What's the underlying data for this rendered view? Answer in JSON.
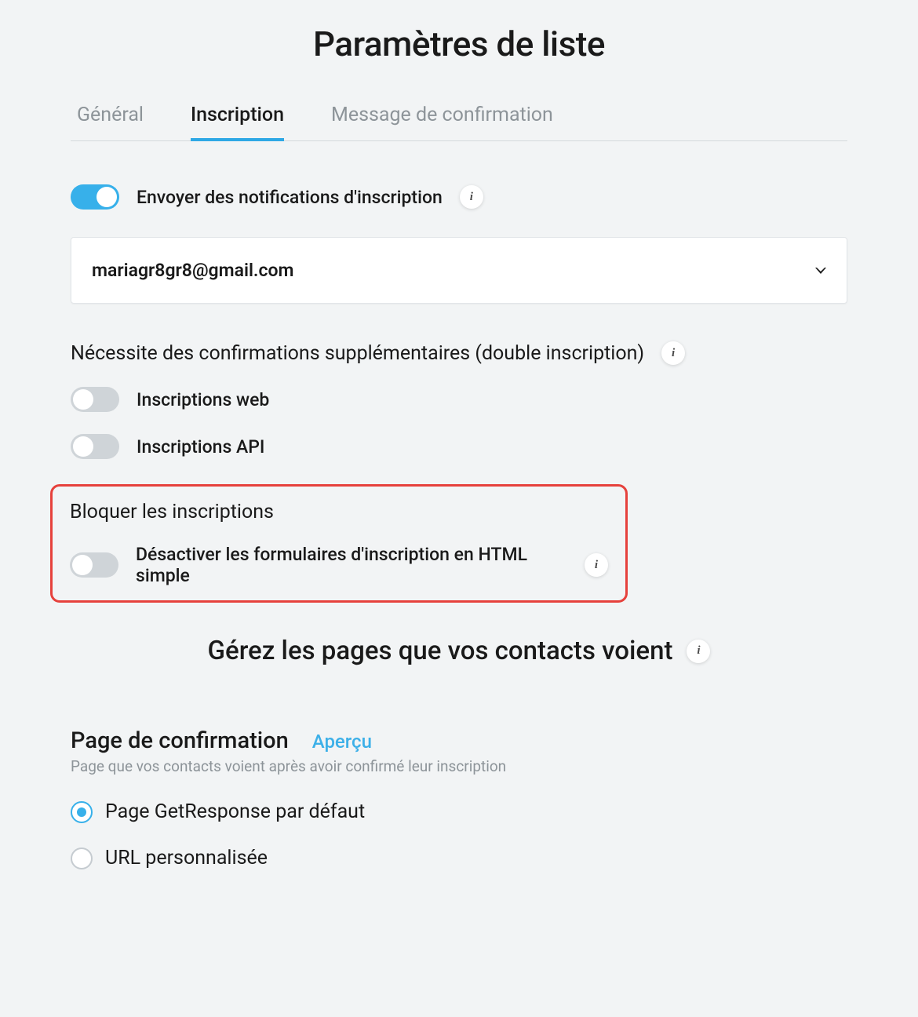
{
  "page_title": "Paramètres de liste",
  "tabs": {
    "general": "Général",
    "inscription": "Inscription",
    "confirmation": "Message de confirmation"
  },
  "notifications": {
    "label": "Envoyer des notifications d'inscription",
    "email": "mariagr8gr8@gmail.com"
  },
  "double_optin": {
    "heading": "Nécessite des confirmations supplémentaires (double inscription)",
    "web_label": "Inscriptions web",
    "api_label": "Inscriptions API"
  },
  "block": {
    "heading": "Bloquer les inscriptions",
    "disable_html_label": "Désactiver les formulaires d'inscription en HTML simple"
  },
  "manage": {
    "heading": "Gérez les pages que vos contacts voient"
  },
  "confirmation_page": {
    "title": "Page de confirmation",
    "preview_label": "Aperçu",
    "description": "Page que vos contacts voient après avoir confirmé leur inscription",
    "option_default": "Page GetResponse par défaut",
    "option_custom": "URL personnalisée"
  }
}
